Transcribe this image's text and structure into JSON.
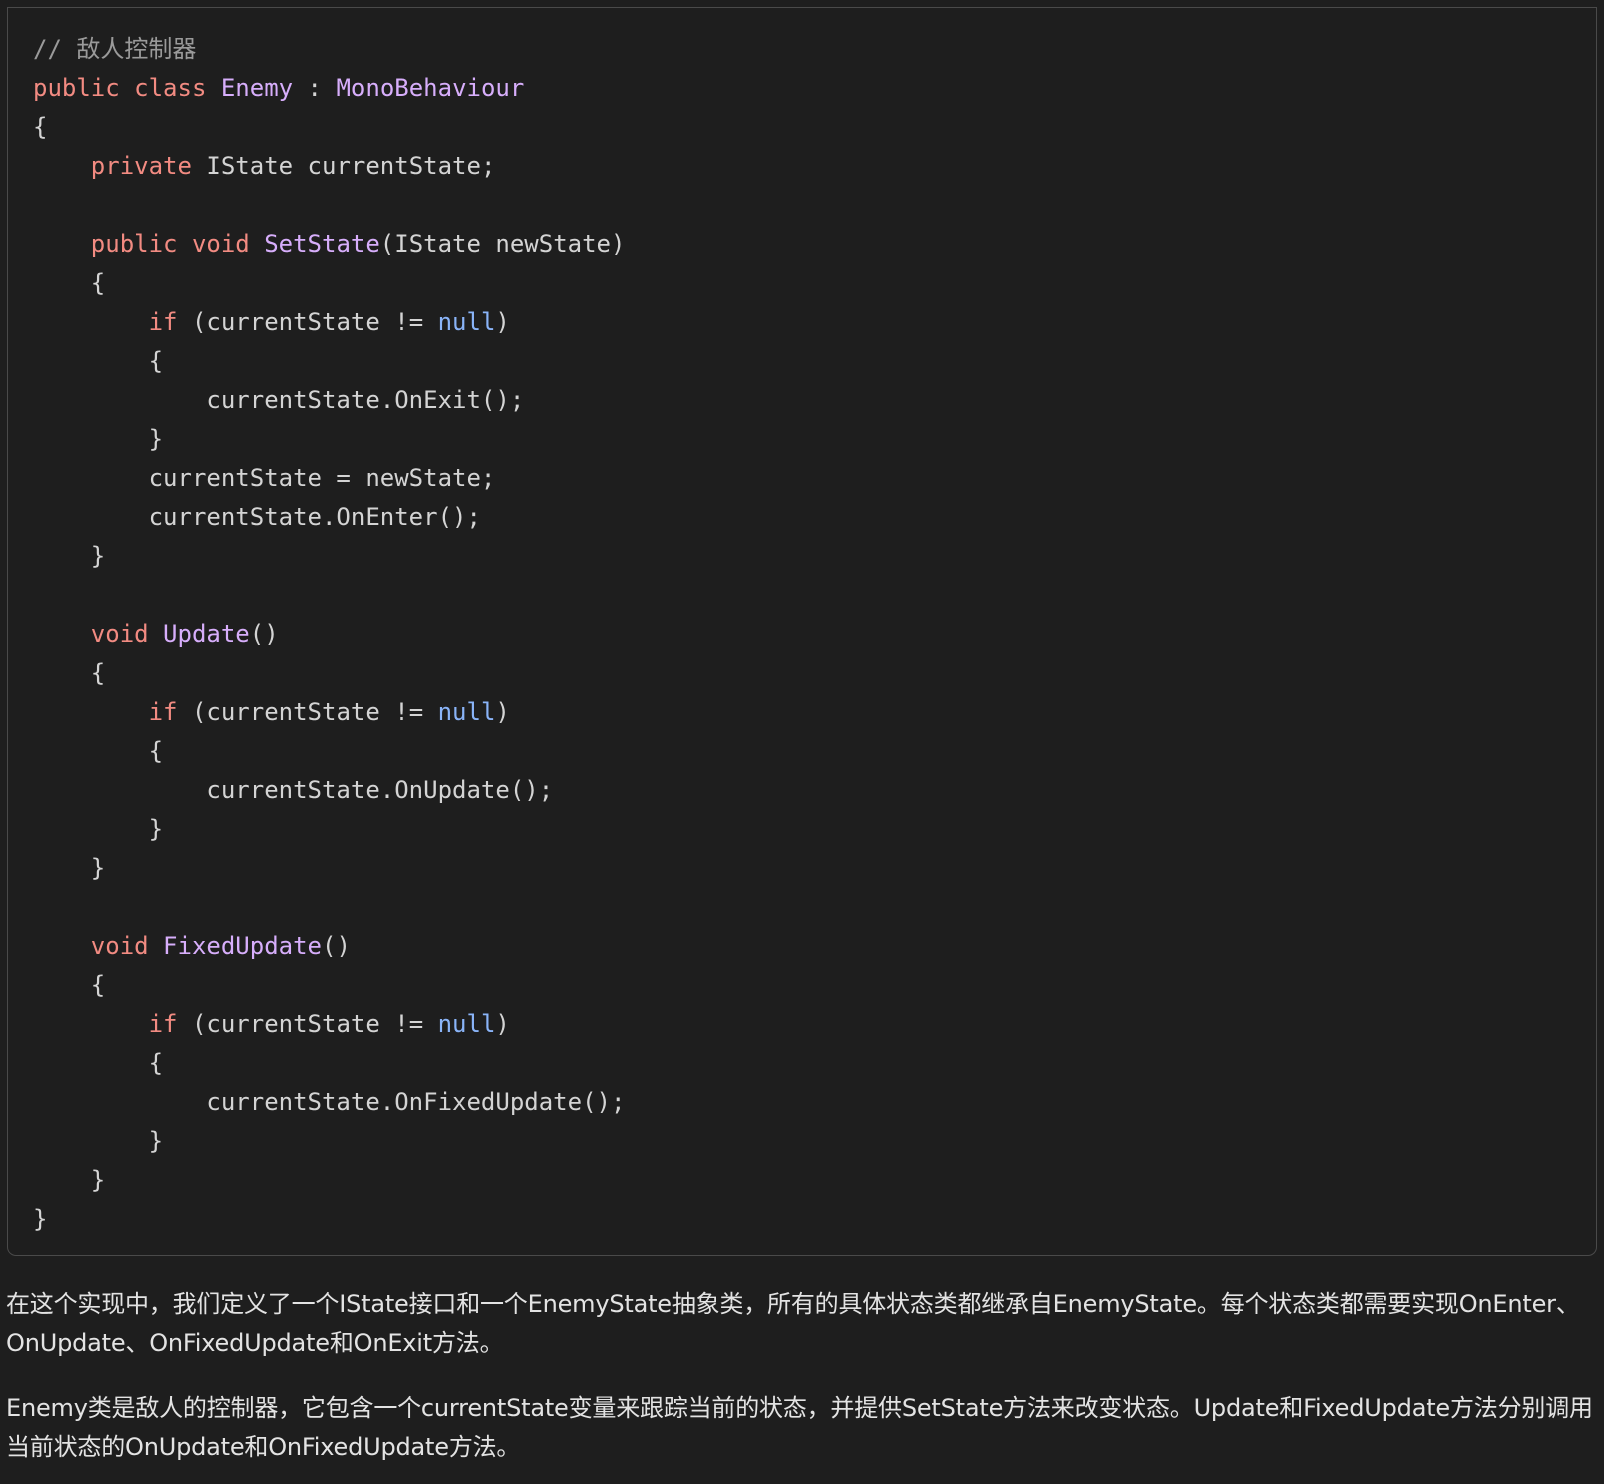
{
  "colors": {
    "background": "#1e1e1e",
    "border": "#4a4a4a",
    "keyword": "#f28b82",
    "type": "#d7aefb",
    "literal": "#8ab4f8",
    "comment": "#9a9a9a",
    "plain": "#d4d4d4",
    "prose": "#e3e3e3"
  },
  "code": {
    "language": "csharp",
    "lines": [
      [
        {
          "t": "comment",
          "v": "// 敌人控制器"
        }
      ],
      [
        {
          "t": "keyword",
          "v": "public"
        },
        {
          "t": "plain",
          "v": " "
        },
        {
          "t": "keyword",
          "v": "class"
        },
        {
          "t": "plain",
          "v": " "
        },
        {
          "t": "type",
          "v": "Enemy"
        },
        {
          "t": "plain",
          "v": " : "
        },
        {
          "t": "type",
          "v": "MonoBehaviour"
        }
      ],
      [
        {
          "t": "plain",
          "v": "{"
        }
      ],
      [
        {
          "t": "plain",
          "v": "    "
        },
        {
          "t": "keyword",
          "v": "private"
        },
        {
          "t": "plain",
          "v": " IState currentState;"
        }
      ],
      [
        {
          "t": "plain",
          "v": ""
        }
      ],
      [
        {
          "t": "plain",
          "v": "    "
        },
        {
          "t": "keyword",
          "v": "public"
        },
        {
          "t": "plain",
          "v": " "
        },
        {
          "t": "keyword",
          "v": "void"
        },
        {
          "t": "plain",
          "v": " "
        },
        {
          "t": "func",
          "v": "SetState"
        },
        {
          "t": "plain",
          "v": "(IState newState)"
        }
      ],
      [
        {
          "t": "plain",
          "v": "    {"
        }
      ],
      [
        {
          "t": "plain",
          "v": "        "
        },
        {
          "t": "keyword",
          "v": "if"
        },
        {
          "t": "plain",
          "v": " (currentState != "
        },
        {
          "t": "literal",
          "v": "null"
        },
        {
          "t": "plain",
          "v": ")"
        }
      ],
      [
        {
          "t": "plain",
          "v": "        {"
        }
      ],
      [
        {
          "t": "plain",
          "v": "            currentState.OnExit();"
        }
      ],
      [
        {
          "t": "plain",
          "v": "        }"
        }
      ],
      [
        {
          "t": "plain",
          "v": "        currentState = newState;"
        }
      ],
      [
        {
          "t": "plain",
          "v": "        currentState.OnEnter();"
        }
      ],
      [
        {
          "t": "plain",
          "v": "    }"
        }
      ],
      [
        {
          "t": "plain",
          "v": ""
        }
      ],
      [
        {
          "t": "plain",
          "v": "    "
        },
        {
          "t": "keyword",
          "v": "void"
        },
        {
          "t": "plain",
          "v": " "
        },
        {
          "t": "func",
          "v": "Update"
        },
        {
          "t": "plain",
          "v": "()"
        }
      ],
      [
        {
          "t": "plain",
          "v": "    {"
        }
      ],
      [
        {
          "t": "plain",
          "v": "        "
        },
        {
          "t": "keyword",
          "v": "if"
        },
        {
          "t": "plain",
          "v": " (currentState != "
        },
        {
          "t": "literal",
          "v": "null"
        },
        {
          "t": "plain",
          "v": ")"
        }
      ],
      [
        {
          "t": "plain",
          "v": "        {"
        }
      ],
      [
        {
          "t": "plain",
          "v": "            currentState.OnUpdate();"
        }
      ],
      [
        {
          "t": "plain",
          "v": "        }"
        }
      ],
      [
        {
          "t": "plain",
          "v": "    }"
        }
      ],
      [
        {
          "t": "plain",
          "v": ""
        }
      ],
      [
        {
          "t": "plain",
          "v": "    "
        },
        {
          "t": "keyword",
          "v": "void"
        },
        {
          "t": "plain",
          "v": " "
        },
        {
          "t": "func",
          "v": "FixedUpdate"
        },
        {
          "t": "plain",
          "v": "()"
        }
      ],
      [
        {
          "t": "plain",
          "v": "    {"
        }
      ],
      [
        {
          "t": "plain",
          "v": "        "
        },
        {
          "t": "keyword",
          "v": "if"
        },
        {
          "t": "plain",
          "v": " (currentState != "
        },
        {
          "t": "literal",
          "v": "null"
        },
        {
          "t": "plain",
          "v": ")"
        }
      ],
      [
        {
          "t": "plain",
          "v": "        {"
        }
      ],
      [
        {
          "t": "plain",
          "v": "            currentState.OnFixedUpdate();"
        }
      ],
      [
        {
          "t": "plain",
          "v": "        }"
        }
      ],
      [
        {
          "t": "plain",
          "v": "    }"
        }
      ],
      [
        {
          "t": "plain",
          "v": "}"
        }
      ]
    ]
  },
  "prose": {
    "paragraph_1": "在这个实现中，我们定义了一个IState接口和一个EnemyState抽象类，所有的具体状态类都继承自EnemyState。每个状态类都需要实现OnEnter、OnUpdate、OnFixedUpdate和OnExit方法。",
    "paragraph_2": "Enemy类是敌人的控制器，它包含一个currentState变量来跟踪当前的状态，并提供SetState方法来改变状态。Update和FixedUpdate方法分别调用当前状态的OnUpdate和OnFixedUpdate方法。"
  }
}
